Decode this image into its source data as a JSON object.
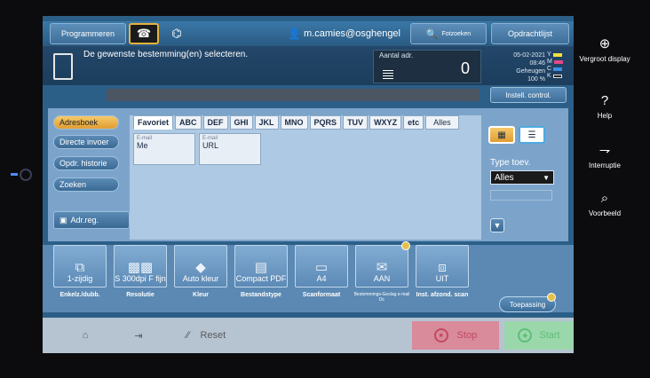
{
  "colors": {
    "accent": "#e6b03a",
    "stop": "#d98a9b",
    "start": "#9ad7ab"
  },
  "header": {
    "program_label": "Programmeren",
    "user_label": "m.camies@osghengel",
    "search_label": "Fotzoeken",
    "jobs_label": "Opdrachtlijst"
  },
  "message": {
    "text": "De gewenste bestemming(en) selecteren.",
    "address_count_label": "Aantal adr.",
    "address_count": "0"
  },
  "status": {
    "date": "05-02-2021",
    "time": "08:46",
    "memory_label": "Geheugen",
    "memory_value": "100 %",
    "ink": [
      {
        "letter": "Y",
        "color": "#f2e13d"
      },
      {
        "letter": "M",
        "color": "#e04a8a"
      },
      {
        "letter": "C",
        "color": "#3c8ee8"
      },
      {
        "letter": "K",
        "color": "#222222"
      }
    ]
  },
  "instell_label": "Instell. control.",
  "side_tabs": [
    "Adresboek",
    "Directe invoer",
    "Opdr. historie",
    "Zoeken"
  ],
  "adrreg_label": "Adr.reg.",
  "index_tabs": [
    "Favoriet",
    "ABC",
    "DEF",
    "GHI",
    "JKL",
    "MNO",
    "PQRS",
    "TUV",
    "WXYZ",
    "etc",
    "Alles"
  ],
  "entries": [
    {
      "kind": "E-mail",
      "name": "Me"
    },
    {
      "kind": "E-mail",
      "name": "URL"
    }
  ],
  "type": {
    "label": "Type toev.",
    "value": "Alles"
  },
  "settings": [
    {
      "value": "1-zijdig",
      "label": "Enkelz./dubb.",
      "icon": "page-icon"
    },
    {
      "value": "S 300dpi F fijn",
      "label": "Resolutie",
      "icon": "grid-icon"
    },
    {
      "value": "Auto kleur",
      "label": "Kleur",
      "icon": "color-icon"
    },
    {
      "value": "Compact PDF",
      "label": "Bestandstype",
      "icon": "pdf-icon"
    },
    {
      "value": "A4",
      "label": "Scanformaat",
      "icon": "paper-icon"
    },
    {
      "value": "AAN",
      "label": "Bestemmings-Geslag e-mail Dc",
      "icon": "mail-icon"
    },
    {
      "value": "UIT",
      "label": "Inst. afzond. scan",
      "icon": "separate-icon"
    }
  ],
  "toepassing_label": "Toepassing",
  "bottom": {
    "reset_label": "Reset",
    "stop_label": "Stop",
    "start_label": "Start"
  },
  "right_panel": [
    {
      "label": "Vergroot display",
      "icon": "zoom-icon"
    },
    {
      "label": "Help",
      "icon": "help-icon"
    },
    {
      "label": "Interruptie",
      "icon": "interrupt-icon"
    },
    {
      "label": "Voorbeeld",
      "icon": "preview-icon"
    }
  ]
}
